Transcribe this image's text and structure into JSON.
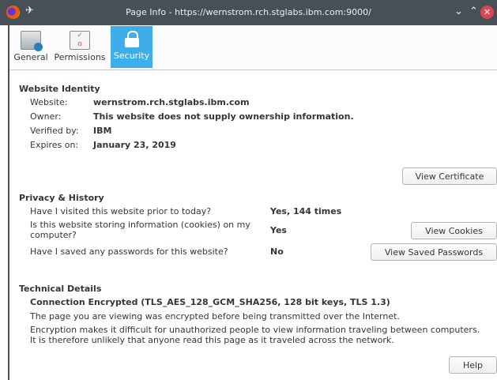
{
  "window": {
    "title": "Page Info - https://wernstrom.rch.stglabs.ibm.com:9000/"
  },
  "tabs": [
    {
      "label": "General",
      "icon": "page-info-icon"
    },
    {
      "label": "Permissions",
      "icon": "permissions-icon"
    },
    {
      "label": "Security",
      "icon": "lock-icon",
      "selected": true
    }
  ],
  "identity": {
    "heading": "Website Identity",
    "website_label": "Website:",
    "website_value": "wernstrom.rch.stglabs.ibm.com",
    "owner_label": "Owner:",
    "owner_value": "This website does not supply ownership information.",
    "verified_label": "Verified by:",
    "verified_value": "IBM",
    "expires_label": "Expires on:",
    "expires_value": "January 23, 2019",
    "view_certificate": "View Certificate"
  },
  "privacy": {
    "heading": "Privacy & History",
    "visited_q": "Have I visited this website prior to today?",
    "visited_a": "Yes, 144 times",
    "cookies_q1": "Is this website storing information (cookies) on my",
    "cookies_q2": "computer?",
    "cookies_a": "Yes",
    "view_cookies": "View Cookies",
    "passwords_q": "Have I saved any passwords for this website?",
    "passwords_a": "No",
    "view_passwords": "View Saved Passwords"
  },
  "technical": {
    "heading": "Technical Details",
    "connection": "Connection Encrypted (TLS_AES_128_GCM_SHA256, 128 bit keys, TLS 1.3)",
    "line1": "The page you are viewing was encrypted before being transmitted over the Internet.",
    "line2": "Encryption makes it difficult for unauthorized people to view information traveling between computers.",
    "line3": "It is therefore unlikely that anyone read this page as it traveled across the network."
  },
  "help": "Help",
  "colors": {
    "titlebar": "#475057",
    "accent": "#3daee9",
    "close": "#da4453"
  }
}
